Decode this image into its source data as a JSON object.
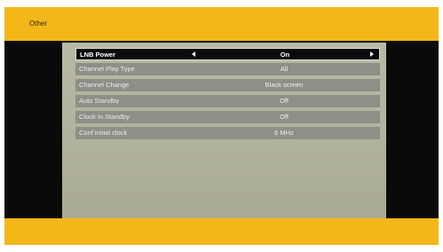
{
  "header": {
    "title": "Other"
  },
  "menu": {
    "items": [
      {
        "label": "LNB Power",
        "value": "On"
      },
      {
        "label": "Channel Play Type",
        "value": "All"
      },
      {
        "label": "Channel Change",
        "value": "Black screen"
      },
      {
        "label": "Auto Standby",
        "value": "Off"
      },
      {
        "label": "Clock In Standby",
        "value": "Off"
      },
      {
        "label": "Conf initial clock",
        "value": "6 MHz"
      }
    ],
    "selected_index": 0
  },
  "colors": {
    "bar": "#f3b71a",
    "background": "#0a0a0a",
    "panel": "#b1b29d",
    "row": "#8e8f86",
    "selected_row": "#0b0b0b"
  }
}
